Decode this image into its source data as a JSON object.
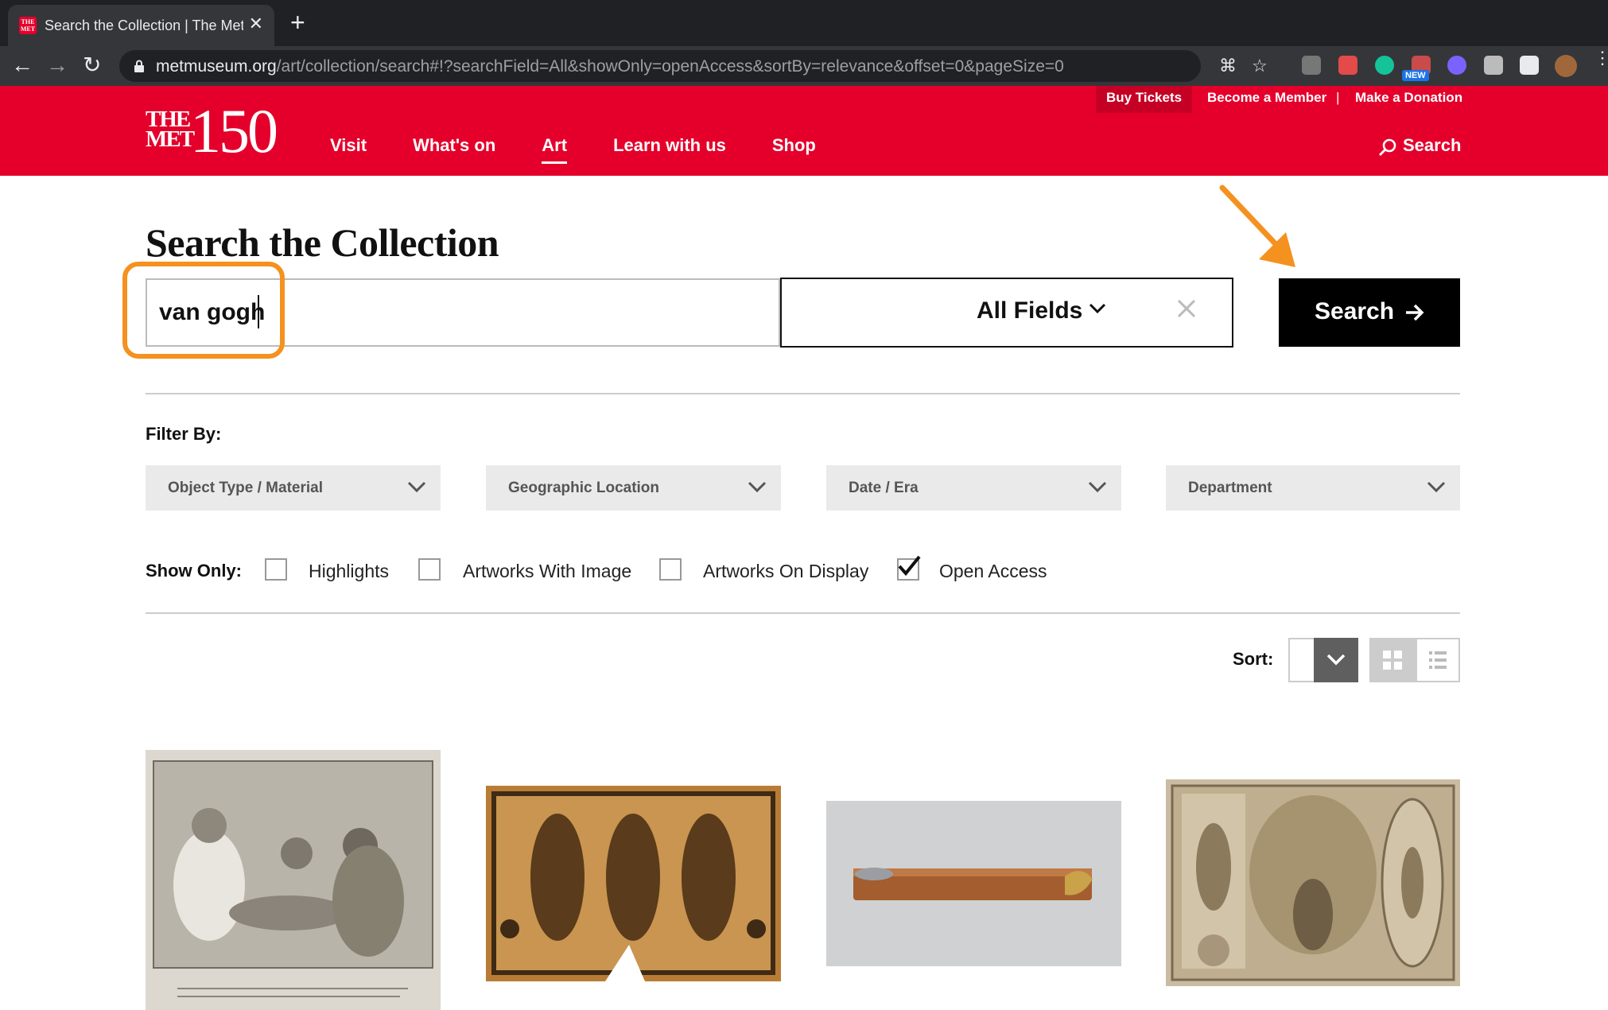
{
  "browser": {
    "tab_title": "Search the Collection | The Met",
    "favicon_text": "THE MET",
    "new_tab_symbol": "+",
    "close_symbol": "✕",
    "url_host": "metmuseum.org",
    "url_path": "/art/collection/search#!?searchField=All&showOnly=openAccess&sortBy=relevance&offset=0&pageSize=0",
    "extension_badge": "NEW"
  },
  "header": {
    "logo_the": "THE",
    "logo_met": "MET",
    "logo_150": "150",
    "nav": [
      "Visit",
      "What's on",
      "Art",
      "Learn with us",
      "Shop"
    ],
    "active_nav": "Art",
    "buy_tickets": "Buy Tickets",
    "become_member": "Become a Member",
    "separator": "|",
    "make_donation": "Make a Donation",
    "search_label": "Search",
    "brand_color": "#e4002b"
  },
  "search": {
    "title": "Search the Collection",
    "query": "van gogh",
    "field_select": "All Fields",
    "button_label": "Search"
  },
  "filters": {
    "label": "Filter By:",
    "dropdowns": [
      "Object Type / Material",
      "Geographic Location",
      "Date / Era",
      "Department"
    ]
  },
  "show_only": {
    "label": "Show Only:",
    "options": [
      {
        "label": "Highlights",
        "checked": false
      },
      {
        "label": "Artworks With Image",
        "checked": false
      },
      {
        "label": "Artworks On Display",
        "checked": false
      },
      {
        "label": "Open Access",
        "checked": true
      }
    ]
  },
  "sort": {
    "label": "Sort:",
    "value": "",
    "view_mode": "grid"
  },
  "results": {
    "thumbnails": [
      "etching-tea-party",
      "textile-fragment-figures",
      "wooden-rod-object",
      "classical-ornament-drawing"
    ]
  },
  "annotations": {
    "highlight_color": "#f5911e"
  }
}
